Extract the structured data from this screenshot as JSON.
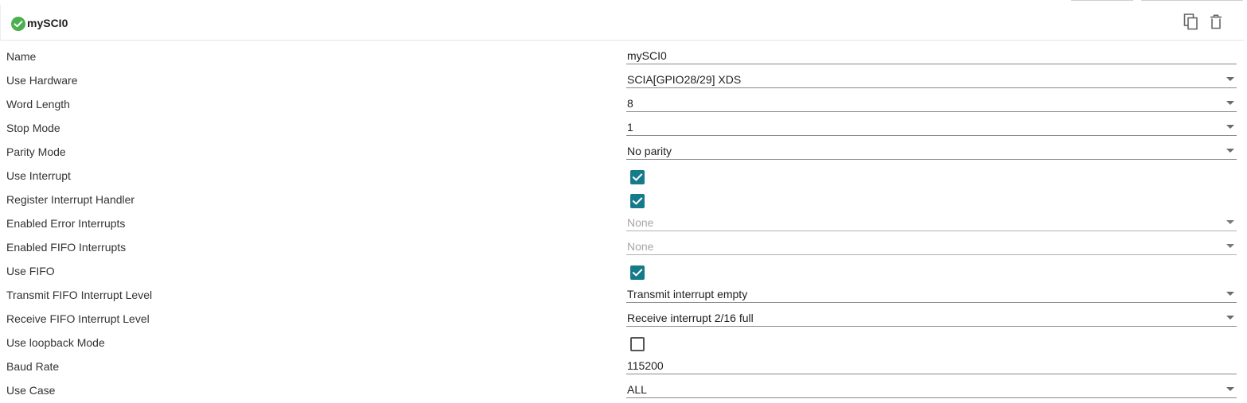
{
  "header": {
    "title": "mySCI0",
    "status_icon": "check-circle-icon",
    "actions": [
      "copy-icon",
      "delete-icon"
    ]
  },
  "colors": {
    "status_ok": "#4caf50",
    "checkbox_checked": "#157b8a",
    "label_text": "#333333",
    "disabled_text": "#a6a6a6"
  },
  "rows": [
    {
      "id": "name",
      "label": "Name",
      "type": "text",
      "value": "mySCI0"
    },
    {
      "id": "use-hardware",
      "label": "Use Hardware",
      "type": "select",
      "value": "SCIA[GPIO28/29] XDS"
    },
    {
      "id": "word-length",
      "label": "Word Length",
      "type": "select",
      "value": "8"
    },
    {
      "id": "stop-mode",
      "label": "Stop Mode",
      "type": "select",
      "value": "1"
    },
    {
      "id": "parity-mode",
      "label": "Parity Mode",
      "type": "select",
      "value": "No parity"
    },
    {
      "id": "use-interrupt",
      "label": "Use Interrupt",
      "type": "checkbox",
      "checked": true
    },
    {
      "id": "register-interrupt-handler",
      "label": "Register Interrupt Handler",
      "type": "checkbox",
      "checked": true
    },
    {
      "id": "enabled-error-interrupts",
      "label": "Enabled Error Interrupts",
      "type": "select",
      "value": "None",
      "disabled": true
    },
    {
      "id": "enabled-fifo-interrupts",
      "label": "Enabled FIFO Interrupts",
      "type": "select",
      "value": "None",
      "disabled": true
    },
    {
      "id": "use-fifo",
      "label": "Use FIFO",
      "type": "checkbox",
      "checked": true
    },
    {
      "id": "transmit-fifo-interrupt-level",
      "label": "Transmit FIFO Interrupt Level",
      "type": "select",
      "value": "Transmit interrupt empty"
    },
    {
      "id": "receive-fifo-interrupt-level",
      "label": "Receive FIFO Interrupt Level",
      "type": "select",
      "value": "Receive interrupt 2/16 full"
    },
    {
      "id": "use-loopback-mode",
      "label": "Use loopback Mode",
      "type": "checkbox",
      "checked": false
    },
    {
      "id": "baud-rate",
      "label": "Baud Rate",
      "type": "text",
      "value": "115200"
    },
    {
      "id": "use-case",
      "label": "Use Case",
      "type": "select",
      "value": "ALL"
    }
  ]
}
